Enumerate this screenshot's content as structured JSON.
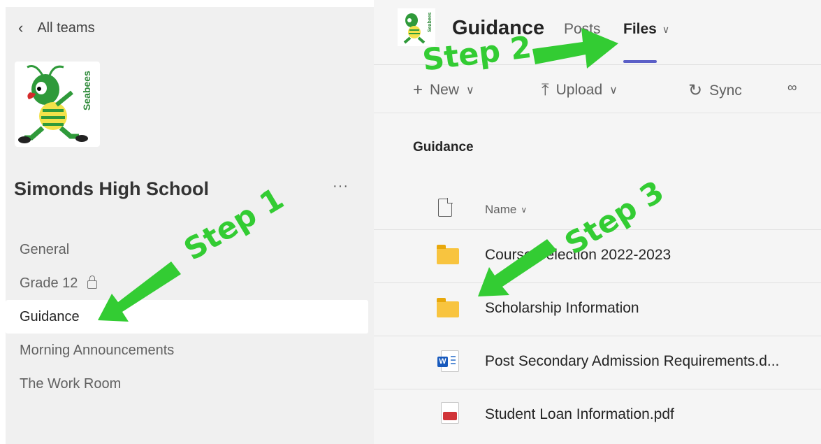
{
  "sidebar": {
    "back_label": "All teams",
    "back_icon": "chevron-left-icon",
    "team_name": "Simonds High School",
    "more_label": "···",
    "logo_text": "Seabees",
    "channels": [
      {
        "label": "General",
        "locked": false,
        "active": false
      },
      {
        "label": "Grade 12",
        "locked": true,
        "active": false
      },
      {
        "label": "Guidance",
        "locked": false,
        "active": true
      },
      {
        "label": "Morning Announcements",
        "locked": false,
        "active": false
      },
      {
        "label": "The Work Room",
        "locked": false,
        "active": false
      }
    ]
  },
  "header": {
    "channel_title": "Guidance",
    "tabs": [
      {
        "label": "Posts",
        "active": false
      },
      {
        "label": "Files",
        "active": true
      }
    ],
    "logo_text": "Seabees",
    "accent_color": "#5b5fc7"
  },
  "toolbar": {
    "new_label": "New",
    "upload_label": "Upload",
    "sync_label": "Sync",
    "new_icon": "plus-icon",
    "upload_icon": "upload-icon",
    "sync_icon": "sync-icon",
    "link_icon": "link-icon"
  },
  "files": {
    "breadcrumb": "Guidance",
    "name_column": "Name",
    "rows": [
      {
        "name": "Course Selection 2022-2023",
        "type": "folder"
      },
      {
        "name": "Scholarship Information",
        "type": "folder"
      },
      {
        "name": "Post Secondary Admission Requirements.d...",
        "type": "word"
      },
      {
        "name": "Student Loan Information.pdf",
        "type": "pdf"
      }
    ]
  },
  "annotations": {
    "step1": "Step 1",
    "step2": "Step 2",
    "step3": "Step 3",
    "color": "#33cc33"
  }
}
